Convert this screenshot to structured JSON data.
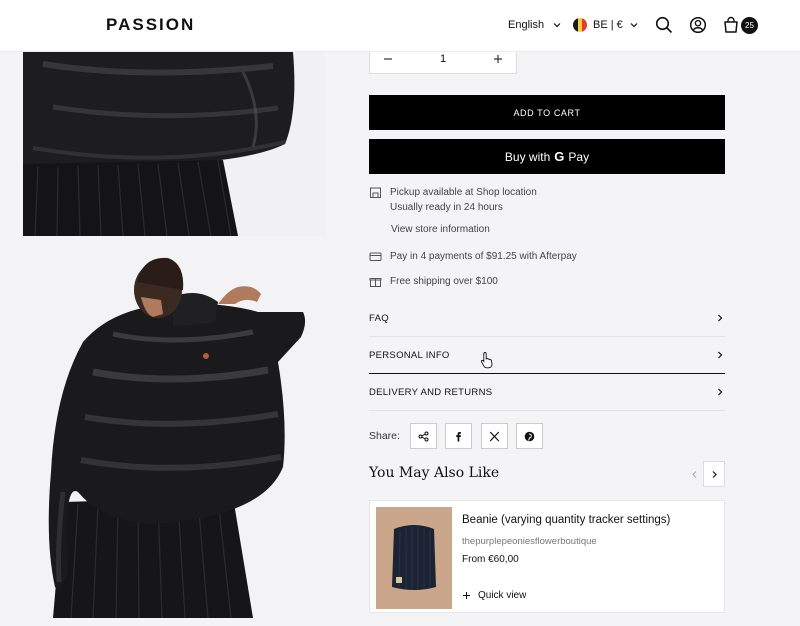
{
  "header": {
    "logo": "PASSION",
    "language": "English",
    "region": "BE | €",
    "flag_colors": [
      "#1a1a1a",
      "#f4d03f",
      "#e53935"
    ],
    "icons": [
      "search-icon",
      "account-icon",
      "cart-icon"
    ],
    "cart_count": "25"
  },
  "purchase": {
    "quantity": "1",
    "add_to_cart": "ADD TO CART",
    "buy_with": "Buy with",
    "gpay_g": "G",
    "gpay_pay": "Pay"
  },
  "pickup": {
    "line1": "Pickup available at Shop location",
    "line2": "Usually ready in 24 hours",
    "link": "View store information"
  },
  "payments": {
    "afterpay": "Pay in 4 payments of $91.25 with Afterpay"
  },
  "shipping": {
    "text": "Free shipping over $100"
  },
  "accordions": [
    {
      "label": "FAQ"
    },
    {
      "label": "PERSONAL INFO"
    },
    {
      "label": "DELIVERY AND RETURNS"
    }
  ],
  "share": {
    "label": "Share:",
    "icons": [
      "share-icon",
      "facebook-icon",
      "x-icon",
      "pinterest-icon"
    ]
  },
  "related": {
    "heading": "You May Also Like",
    "product": {
      "title": "Beanie (varying quantity tracker settings)",
      "vendor": "thepurplepeoniesflowerboutique",
      "price": "From €60,00",
      "quick_view": "Quick view"
    }
  },
  "colors": {
    "accent": "#000000",
    "background": "#f4f4f6"
  }
}
